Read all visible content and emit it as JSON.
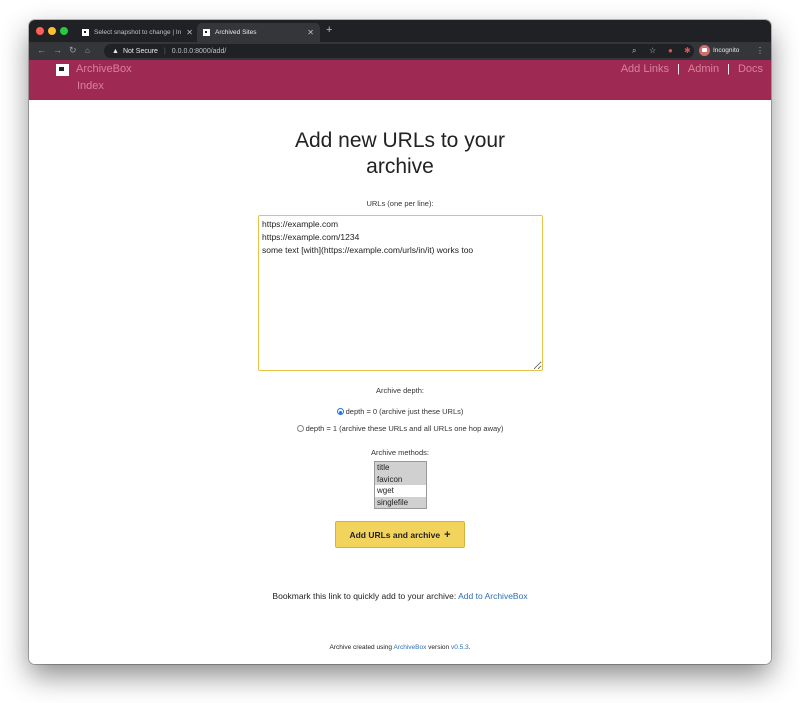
{
  "colors": {
    "header_bg": "#9e2a54",
    "accent_button": "#f2d45c",
    "link": "#2d6eb5"
  },
  "browser": {
    "tabs": [
      {
        "title": "Select snapshot to change | In",
        "active": false
      },
      {
        "title": "Archived Sites",
        "active": true
      }
    ],
    "new_tab_icon": "+",
    "address": {
      "security_label": "Not Secure",
      "url": "0.0.0.0:8000/add/"
    },
    "profile_label": "Incognito"
  },
  "header": {
    "brand": "ArchiveBox",
    "brand_sub": "Index",
    "nav": [
      "Add Links",
      "Admin",
      "Docs"
    ],
    "separator": "|"
  },
  "form": {
    "title": "Add new URLs to your archive",
    "urls_label": "URLs (one per line):",
    "urls_value": "https://example.com\nhttps://example.com/1234\nsome text [with](https://example.com/urls/in/it) works too",
    "depth_label": "Archive depth:",
    "depth_options": [
      {
        "label": "depth = 0 (archive just these URLs)",
        "checked": true
      },
      {
        "label": "depth = 1 (archive these URLs and all URLs one hop away)",
        "checked": false
      }
    ],
    "methods_label": "Archive methods:",
    "methods": [
      {
        "label": "title",
        "selected": true
      },
      {
        "label": "favicon",
        "selected": true
      },
      {
        "label": "wget",
        "selected": false
      },
      {
        "label": "singlefile",
        "selected": true
      }
    ],
    "submit_label": "Add URLs and archive",
    "submit_icon": "+"
  },
  "bookmark": {
    "text": "Bookmark this link to quickly add to your archive:",
    "link_text": "Add to ArchiveBox"
  },
  "footer": {
    "prefix": "Archive created using",
    "link_text": "ArchiveBox",
    "middle": "version",
    "version": "v0.5.3",
    "suffix": "."
  }
}
